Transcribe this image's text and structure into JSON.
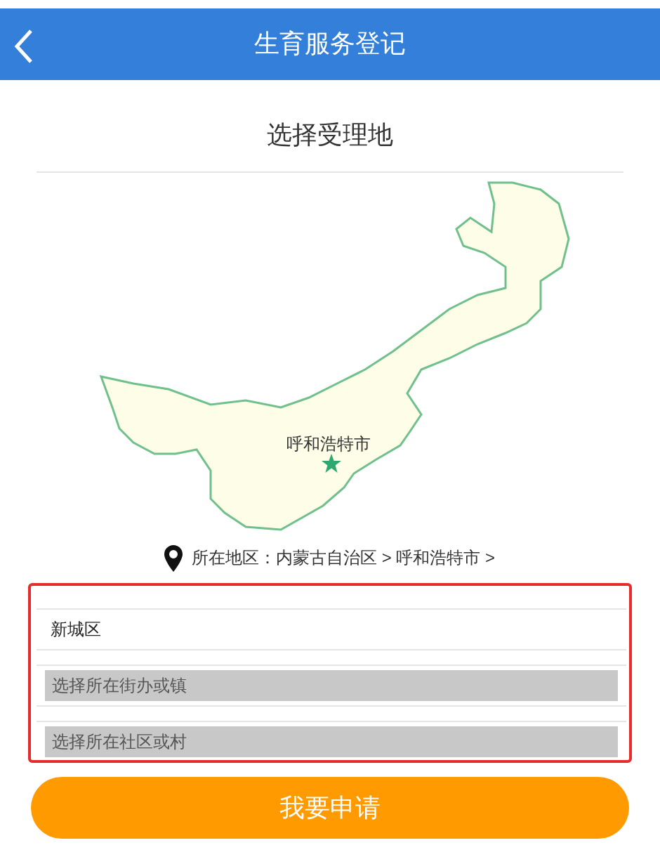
{
  "header": {
    "title": "生育服务登记"
  },
  "section_title": "选择受理地",
  "map": {
    "city_label": "呼和浩特市"
  },
  "location": {
    "label": "所在地区：内蒙古自治区 > 呼和浩特市 >"
  },
  "fields": [
    {
      "kind": "value",
      "value": "新城区"
    },
    {
      "kind": "select",
      "placeholder": "选择所在街办或镇"
    },
    {
      "kind": "select",
      "placeholder": "选择所在社区或村"
    }
  ],
  "submit_button": "我要申请"
}
